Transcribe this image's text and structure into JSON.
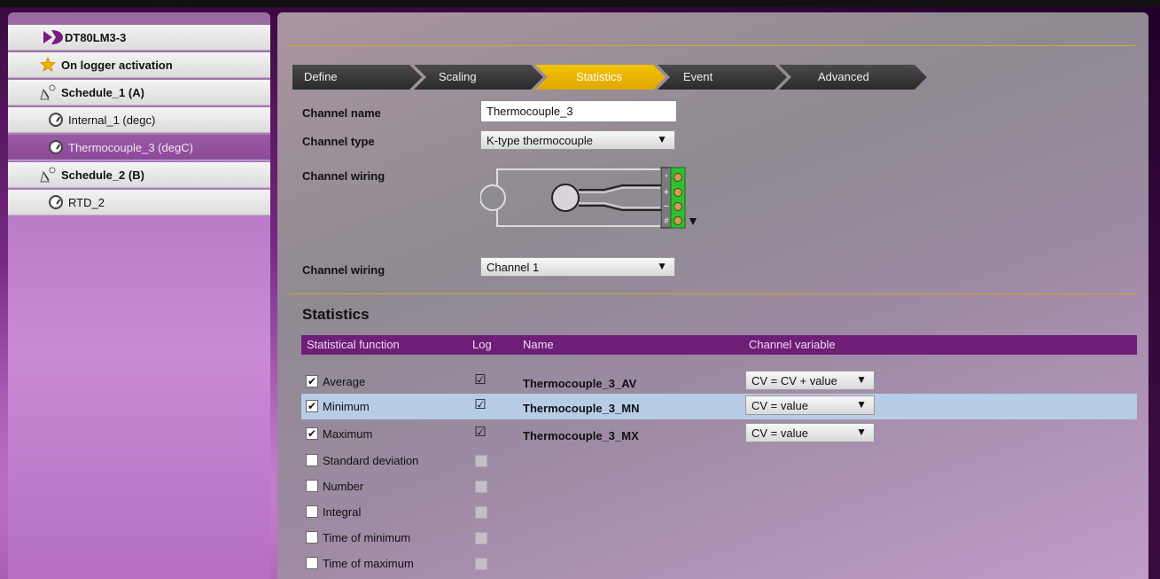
{
  "sidebar": {
    "items": [
      {
        "label": "DT80LM3-3",
        "icon": "datataker-logo-icon"
      },
      {
        "label": "On logger activation",
        "icon": "star-icon"
      },
      {
        "label": "Schedule_1 (A)",
        "icon": "schedule-icon"
      },
      {
        "label": "Internal_1 (degc)",
        "icon": "gauge-icon"
      },
      {
        "label": "Thermocouple_3 (degC)",
        "icon": "gauge-icon"
      },
      {
        "label": "Schedule_2 (B)",
        "icon": "schedule-icon"
      },
      {
        "label": "RTD_2",
        "icon": "gauge-icon"
      }
    ]
  },
  "wizard": {
    "steps": [
      "Define",
      "Scaling",
      "Statistics",
      "Event",
      "Advanced"
    ],
    "active": "Statistics"
  },
  "form": {
    "channel_name_label": "Channel name",
    "channel_name_value": "Thermocouple_3",
    "channel_type_label": "Channel type",
    "channel_type_value": "K-type thermocouple",
    "wiring_label": "Channel wiring",
    "wiring2_label": "Channel wiring",
    "wiring2_value": "Channel 1",
    "terminal_signs": [
      "*",
      "+",
      "−",
      "#"
    ]
  },
  "statistics": {
    "title": "Statistics",
    "headers": {
      "function": "Statistical function",
      "log": "Log",
      "name": "Name",
      "cv": "Channel variable"
    },
    "rows": [
      {
        "label": "Average",
        "checked": true,
        "log": true,
        "name": "Thermocouple_3_AV",
        "cv": "CV = CV + value"
      },
      {
        "label": "Minimum",
        "checked": true,
        "log": true,
        "name": "Thermocouple_3_MN",
        "cv": "CV = value"
      },
      {
        "label": "Maximum",
        "checked": true,
        "log": true,
        "name": "Thermocouple_3_MX",
        "cv": "CV = value"
      },
      {
        "label": "Standard deviation",
        "checked": false
      },
      {
        "label": "Number",
        "checked": false
      },
      {
        "label": "Integral",
        "checked": false
      },
      {
        "label": "Time of minimum",
        "checked": false
      },
      {
        "label": "Time of maximum",
        "checked": false
      }
    ]
  },
  "colors": {
    "accent": "#f3c200",
    "header": "#6e1e76",
    "highlight": "#b7cde6",
    "selected": "#8a4a98"
  }
}
